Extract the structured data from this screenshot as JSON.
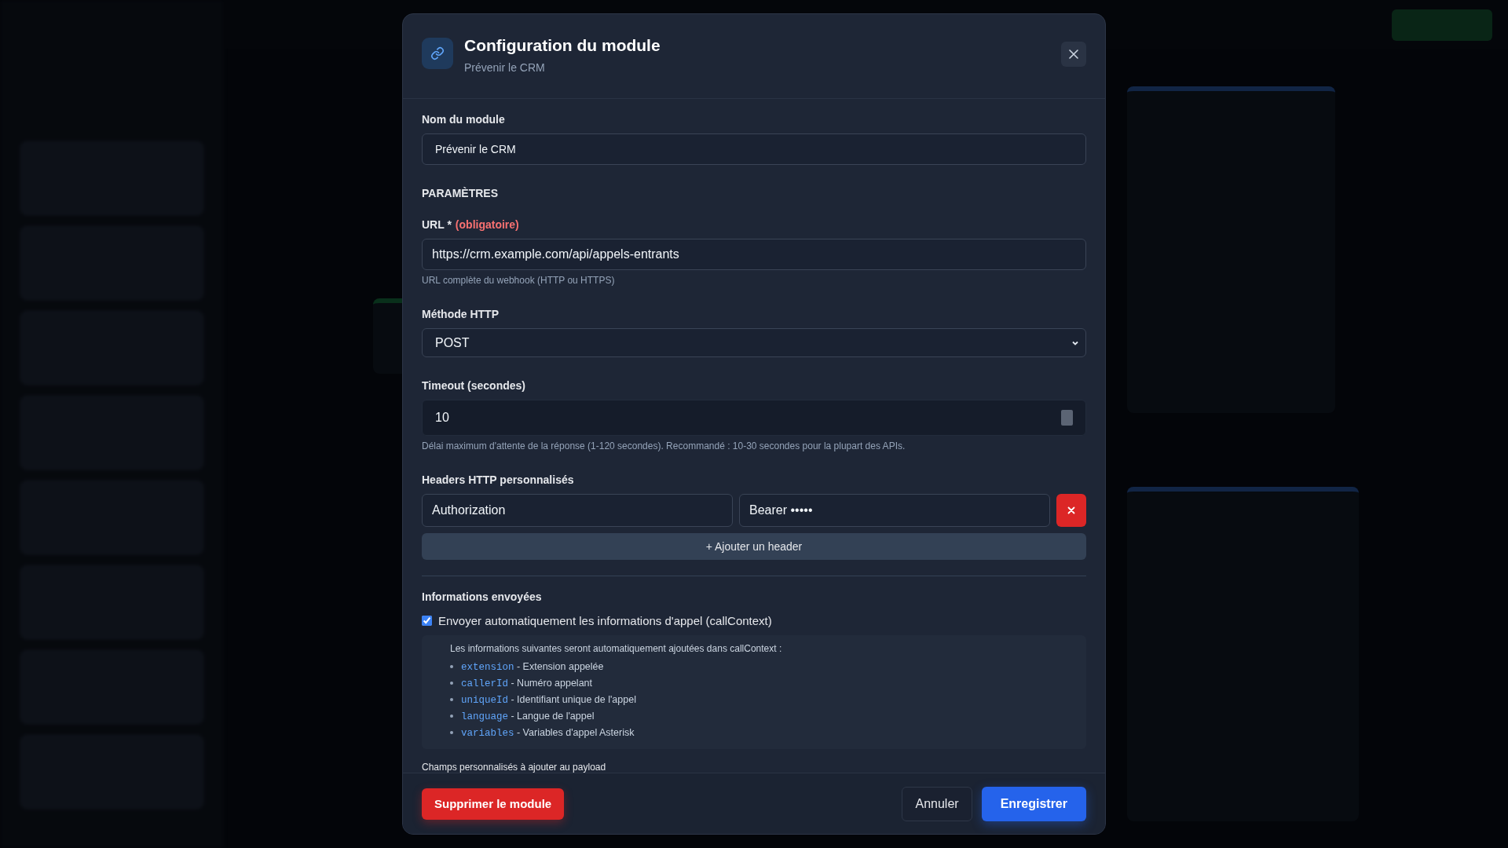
{
  "modal": {
    "title": "Configuration du module",
    "subtitle": "Prévenir le CRM"
  },
  "name_field": {
    "label": "Nom du module",
    "value": "Prévenir le CRM"
  },
  "section_heading": "PARAMÈTRES",
  "url_field": {
    "label": "URL *",
    "required_note": "(obligatoire)",
    "value": "https://crm.example.com/api/appels-entrants",
    "help": "URL complète du webhook (HTTP ou HTTPS)"
  },
  "method_field": {
    "label": "Méthode HTTP",
    "value": "POST"
  },
  "timeout_field": {
    "label": "Timeout (secondes)",
    "value": "10",
    "help": "Délai maximum d'attente de la réponse (1-120 secondes). Recommandé : 10-30 secondes pour la plupart des APIs."
  },
  "headers": {
    "label": "Headers HTTP personnalisés",
    "rows": [
      {
        "key": "Authorization",
        "value": "Bearer •••••"
      }
    ],
    "add_button": "+ Ajouter un header"
  },
  "info": {
    "heading": "Informations envoyées",
    "checkbox": {
      "label": "Envoyer automatiquement les informations d'appel (callContext)",
      "checked": true
    },
    "intro": "Les informations suivantes seront automatiquement ajoutées dans callContext :",
    "items": [
      {
        "code": "extension",
        "text": "- Extension appelée"
      },
      {
        "code": "callerId",
        "text": "- Numéro appelant"
      },
      {
        "code": "uniqueId",
        "text": "- Identifiant unique de l'appel"
      },
      {
        "code": "language",
        "text": "- Langue de l'appel"
      },
      {
        "code": "variables",
        "text": "- Variables d'appel Asterisk"
      }
    ]
  },
  "custom_fields_label": "Champs personnalisés à ajouter au payload",
  "footer": {
    "delete_button": "Supprimer le module",
    "cancel_button": "Annuler",
    "save_button": "Enregistrer"
  }
}
